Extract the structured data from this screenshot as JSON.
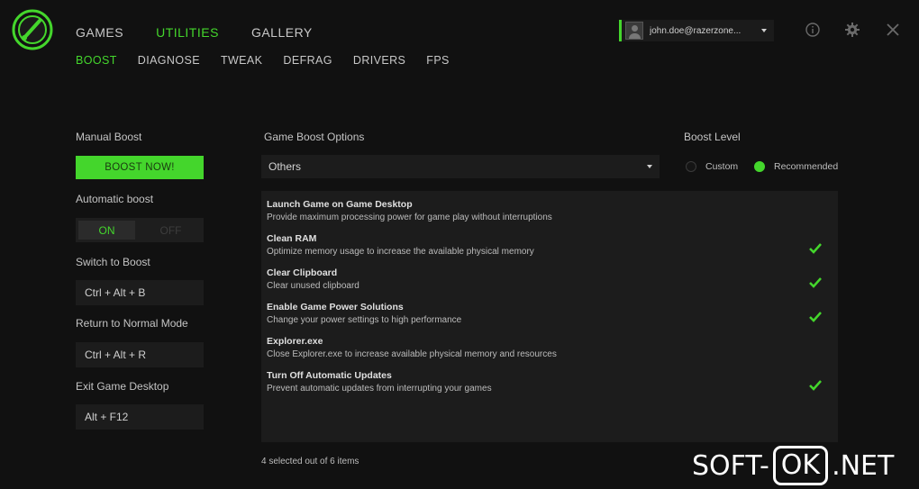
{
  "nav": {
    "top": [
      "GAMES",
      "UTILITIES",
      "GALLERY"
    ],
    "active_top": 1,
    "sub": [
      "BOOST",
      "DIAGNOSE",
      "TWEAK",
      "DEFRAG",
      "DRIVERS",
      "FPS"
    ],
    "active_sub": 0
  },
  "account": {
    "email": "john.doe@razerzone..."
  },
  "icons": [
    "razer-cortex-logo",
    "info-icon",
    "gear-icon",
    "close-icon",
    "checkmark-icon"
  ],
  "colors": {
    "accent": "#44d62c",
    "background": "#111111",
    "panel": "#1c1c1c"
  },
  "left": {
    "manual_boost_label": "Manual Boost",
    "boost_button": "BOOST NOW!",
    "auto_boost_label": "Automatic boost",
    "toggle_on": "ON",
    "toggle_off": "OFF",
    "switch_label": "Switch to Boost",
    "switch_value": "Ctrl + Alt + B",
    "return_label": "Return to Normal Mode",
    "return_value": "Ctrl + Alt + R",
    "exit_label": "Exit Game Desktop",
    "exit_value": "Alt + F12"
  },
  "options": {
    "title": "Game Boost Options",
    "selected": "Others",
    "items": [
      {
        "title": "Launch Game on Game Desktop",
        "desc": "Provide maximum processing power for game play without interruptions",
        "checked": false
      },
      {
        "title": "Clean RAM",
        "desc": "Optimize memory usage to increase the available physical memory",
        "checked": true
      },
      {
        "title": "Clear Clipboard",
        "desc": "Clear unused clipboard",
        "checked": true
      },
      {
        "title": "Enable Game Power Solutions",
        "desc": "Change your power settings to high performance",
        "checked": true
      },
      {
        "title": "Explorer.exe",
        "desc": "Close Explorer.exe to increase available physical memory and resources",
        "checked": false
      },
      {
        "title": "Turn Off Automatic Updates",
        "desc": "Prevent automatic updates from interrupting your games",
        "checked": true
      }
    ],
    "footer": "4 selected out of 6 items"
  },
  "boost_level": {
    "title": "Boost Level",
    "custom": "Custom",
    "recommended": "Recommended",
    "selected": "Recommended"
  },
  "watermark": {
    "left": "SOFT-",
    "mid": "OK",
    "right": ".NET"
  }
}
